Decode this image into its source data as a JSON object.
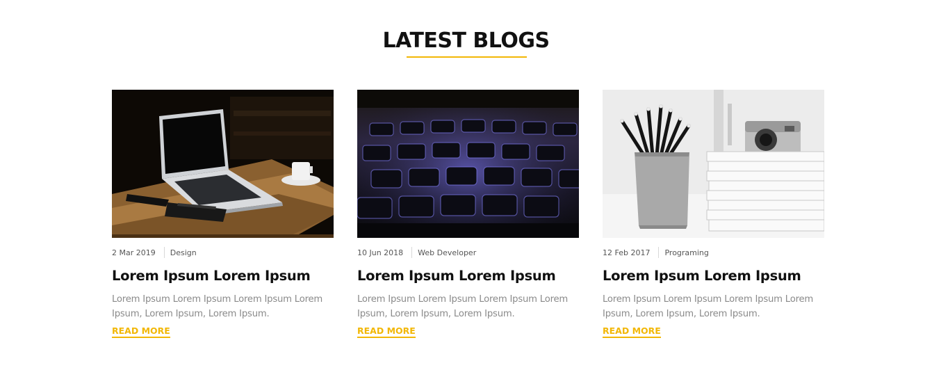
{
  "section": {
    "heading": "LATEST BLOGS",
    "accent_color": "#f2b705"
  },
  "posts": [
    {
      "date": "2 Mar 2019",
      "category": "Design",
      "title": "Lorem Ipsum Lorem Ipsum",
      "excerpt": "Lorem Ipsum Lorem Ipsum Lorem Ipsum Lorem Ipsum, Lorem Ipsum, Lorem Ipsum.",
      "read_more": "READ MORE",
      "image": "laptop-on-wooden-table"
    },
    {
      "date": "10 Jun 2018",
      "category": "Web Developer",
      "title": "Lorem Ipsum Lorem Ipsum",
      "excerpt": "Lorem Ipsum Lorem Ipsum Lorem Ipsum Lorem Ipsum, Lorem Ipsum, Lorem Ipsum.",
      "read_more": "READ MORE",
      "image": "backlit-keyboard"
    },
    {
      "date": "12 Feb 2017",
      "category": "Programing",
      "title": "Lorem Ipsum Lorem Ipsum",
      "excerpt": "Lorem Ipsum Lorem Ipsum Lorem Ipsum Lorem Ipsum, Lorem Ipsum, Lorem Ipsum.",
      "read_more": "READ MORE",
      "image": "pencil-cup-and-magazines"
    }
  ]
}
